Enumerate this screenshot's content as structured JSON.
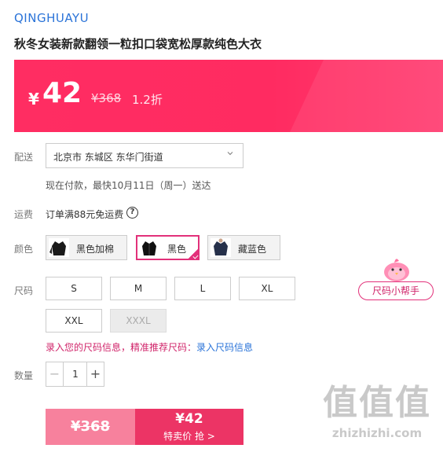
{
  "brand": "QINGHUAYU",
  "product_title": "秋冬女装新款翻领一粒扣口袋宽松厚款纯色大衣",
  "price": {
    "currency": "¥",
    "current": "42",
    "original": "¥368",
    "discount": "1.2折"
  },
  "delivery": {
    "label": "配送",
    "address": "北京市 东城区 东华门街道",
    "note": "现在付款，最快10月11日（周一）送达"
  },
  "shipping": {
    "label": "运费",
    "text": "订单满88元免运费",
    "help_icon": "?"
  },
  "color": {
    "label": "颜色",
    "options": [
      {
        "name": "黑色加棉",
        "selected": false
      },
      {
        "name": "黑色",
        "selected": true
      },
      {
        "name": "藏蓝色",
        "selected": false
      }
    ]
  },
  "size": {
    "label": "尺码",
    "options": [
      {
        "name": "S",
        "available": true
      },
      {
        "name": "M",
        "available": true
      },
      {
        "name": "L",
        "available": true
      },
      {
        "name": "XL",
        "available": true
      },
      {
        "name": "XXL",
        "available": true
      },
      {
        "name": "XXXL",
        "available": false
      }
    ],
    "hint_text": "录入您的尺码信息，精准推荐尺码：",
    "hint_link": "录入尺码信息",
    "helper_label": "尺码小帮手"
  },
  "quantity": {
    "label": "数量",
    "value": "1",
    "minus": "−",
    "plus": "+"
  },
  "buttons": {
    "original_price": "¥368",
    "buy_price": "¥42",
    "buy_label": "特卖价 抢 >"
  },
  "watermark": {
    "logo": "值值值",
    "site": "zhizhizhi.com"
  },
  "colors": {
    "accent": "#ff2d62",
    "link": "#2a73d8",
    "selected_border": "#e2317a"
  }
}
